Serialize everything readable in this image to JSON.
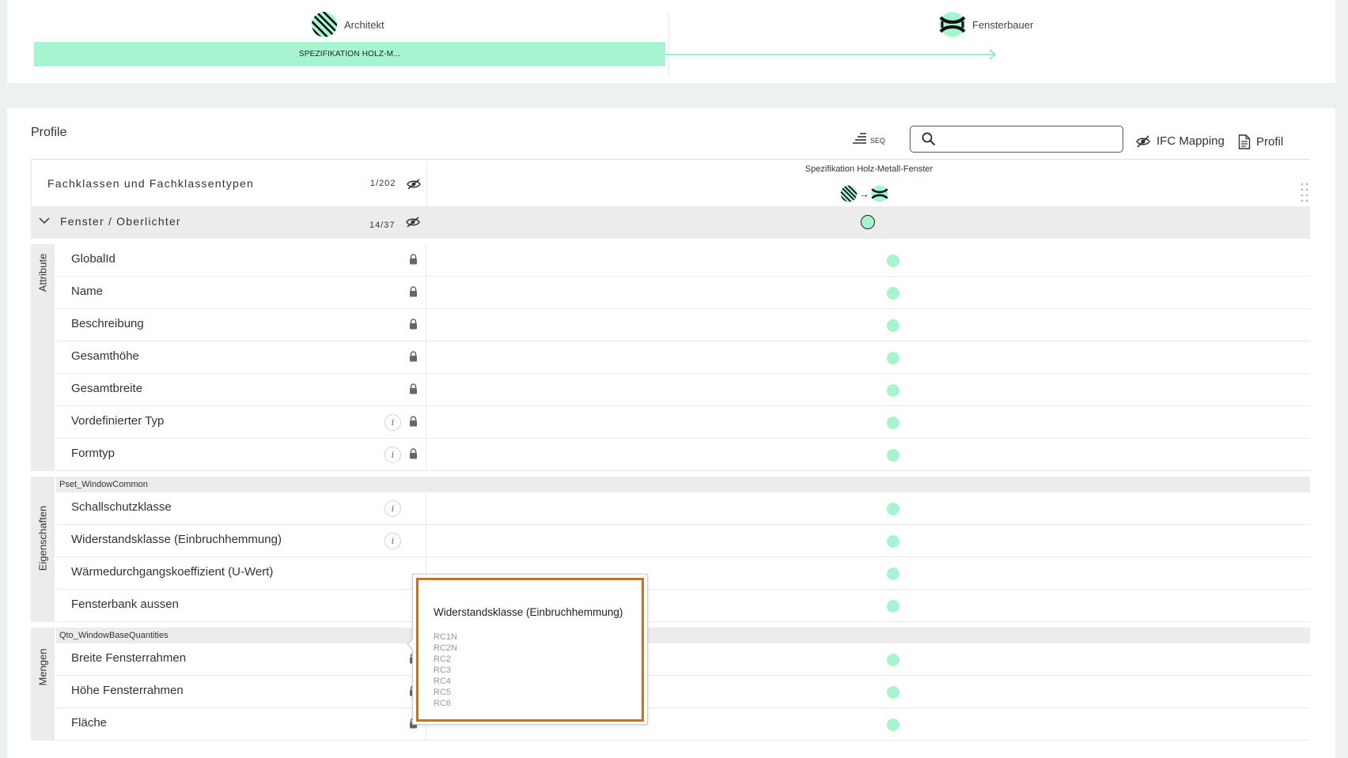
{
  "process": {
    "actors": [
      {
        "name": "Architekt",
        "icon": "architekt-avatar-icon"
      },
      {
        "name": "Fensterbauer",
        "icon": "fensterbauer-avatar-icon"
      }
    ],
    "spec_label": "SPEZIFIKATION HOLZ-M..."
  },
  "toolbar": {
    "title": "Profile",
    "seq_label": "SEQ",
    "search_placeholder": "",
    "ifc_label": "IFC Mapping",
    "profil_label": "Profil"
  },
  "table": {
    "header_label": "Fachklassen und Fachklassentypen",
    "header_count": "1/202",
    "column_title": "Spezifikation Holz-Metall-Fenster",
    "flow_arrow": "→",
    "group_label": "Fenster / Oberlichter",
    "group_count": "14/37",
    "sections": [
      {
        "side": "Attribute",
        "pset": "",
        "rows": [
          {
            "label": "GlobalId",
            "info": false,
            "lock": true
          },
          {
            "label": "Name",
            "info": false,
            "lock": true
          },
          {
            "label": "Beschreibung",
            "info": false,
            "lock": true
          },
          {
            "label": "Gesamthöhe",
            "info": false,
            "lock": true
          },
          {
            "label": "Gesamtbreite",
            "info": false,
            "lock": true
          },
          {
            "label": "Vordefinierter Typ",
            "info": true,
            "lock": true
          },
          {
            "label": "Formtyp",
            "info": true,
            "lock": true
          }
        ]
      },
      {
        "side": "Eigenschaften",
        "pset": "Pset_WindowCommon",
        "rows": [
          {
            "label": "Schallschutzklasse",
            "info": true,
            "lock": false
          },
          {
            "label": "Widerstandsklasse (Einbruchhemmung)",
            "info": true,
            "lock": false
          },
          {
            "label": "Wärmedurchgangskoeffizient (U-Wert)",
            "info": false,
            "lock": false
          },
          {
            "label": "Fensterbank aussen",
            "info": false,
            "lock": false
          }
        ]
      },
      {
        "side": "Mengen",
        "pset": "Qto_WindowBaseQuantities",
        "rows": [
          {
            "label": "Breite Fensterrahmen",
            "info": false,
            "lock": true
          },
          {
            "label": "Höhe Fensterrahmen",
            "info": false,
            "lock": true
          },
          {
            "label": "Fläche",
            "info": false,
            "lock": true
          }
        ]
      }
    ]
  },
  "tooltip": {
    "title": "Widerstandsklasse (Einbruchhemmung)",
    "items": [
      "RC1N",
      "RC2N",
      "RC2",
      "RC3",
      "RC4",
      "RC5",
      "RC6"
    ]
  },
  "colors": {
    "accent": "#a6f5d0",
    "tooltip_border": "#c8721d",
    "group_bg": "#ececec"
  }
}
